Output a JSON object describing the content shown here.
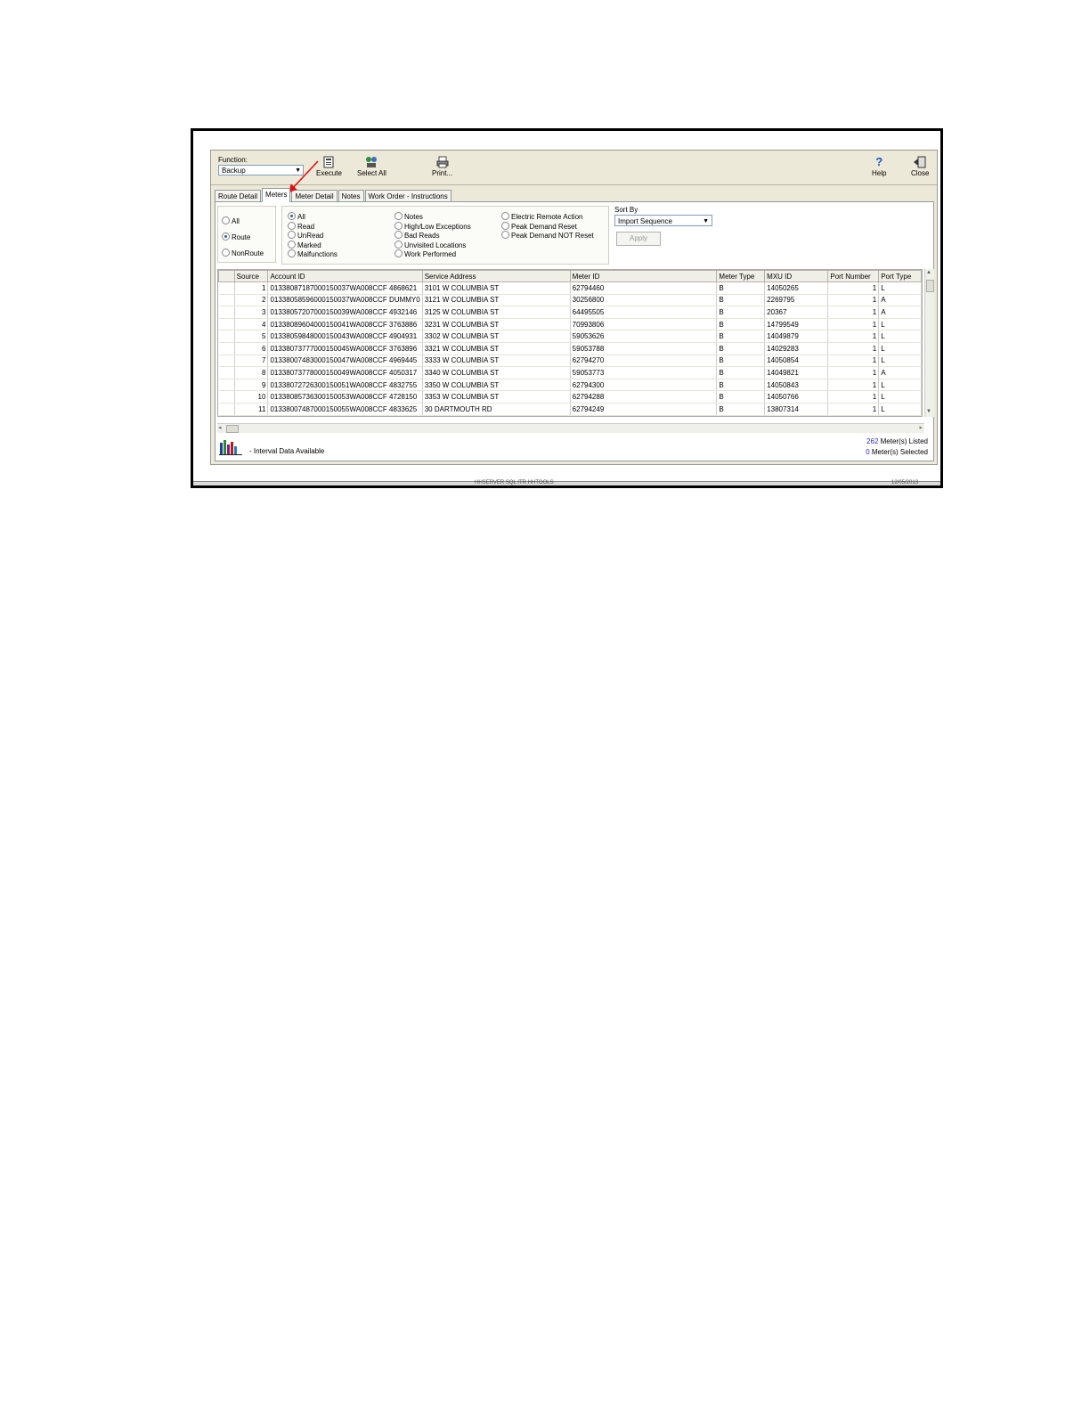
{
  "toolbar": {
    "function_label": "Function:",
    "function_value": "Backup",
    "execute_label": "Execute",
    "select_all_label": "Select All",
    "print_label": "Print...",
    "help_label": "Help",
    "close_label": "Close"
  },
  "tabs": [
    {
      "label": "Route Detail"
    },
    {
      "label": "Meters"
    },
    {
      "label": "Meter Detail"
    },
    {
      "label": "Notes"
    },
    {
      "label": "Work Order - Instructions"
    }
  ],
  "scope_filter": {
    "options": [
      {
        "label": "All",
        "selected": false
      },
      {
        "label": "Route",
        "selected": true
      },
      {
        "label": "NonRoute",
        "selected": false
      }
    ]
  },
  "status_filter": {
    "col1": [
      {
        "label": "All",
        "selected": true
      },
      {
        "label": "Read",
        "selected": false
      },
      {
        "label": "UnRead",
        "selected": false
      },
      {
        "label": "Marked",
        "selected": false
      },
      {
        "label": "Malfunctions",
        "selected": false
      }
    ],
    "col2": [
      {
        "label": "Notes",
        "selected": false
      },
      {
        "label": "High/Low Exceptions",
        "selected": false
      },
      {
        "label": "Bad Reads",
        "selected": false
      },
      {
        "label": "Unvisited Locations",
        "selected": false
      },
      {
        "label": "Work Performed",
        "selected": false
      }
    ],
    "col3": [
      {
        "label": "Electric Remote Action",
        "selected": false
      },
      {
        "label": "Peak Demand Reset",
        "selected": false
      },
      {
        "label": "Peak Demand NOT Reset",
        "selected": false
      }
    ]
  },
  "sort": {
    "label": "Sort By",
    "value": "Import Sequence",
    "apply_label": "Apply"
  },
  "grid": {
    "columns": [
      "Source",
      "Account ID",
      "Service Address",
      "Meter ID",
      "Meter Type",
      "MXU ID",
      "Port Number",
      "Port Type"
    ],
    "rows": [
      [
        "1",
        "01338087187000150037WA008CCF 4868621",
        "3101 W COLUMBIA ST",
        "62794460",
        "B",
        "14050265",
        "1",
        "L"
      ],
      [
        "2",
        "01338058596000150037WA008CCF DUMMY0",
        "3121 W COLUMBIA ST",
        "30256800",
        "B",
        "2269795",
        "1",
        "A"
      ],
      [
        "3",
        "01338057207000150039WA008CCF 4932146",
        "3125 W COLUMBIA ST",
        "64495505",
        "B",
        "20367",
        "1",
        "A"
      ],
      [
        "4",
        "01338089604000150041WA008CCF 3763886",
        "3231 W COLUMBIA ST",
        "70993806",
        "B",
        "14799549",
        "1",
        "L"
      ],
      [
        "5",
        "01338059848000150043WA008CCF 4904931",
        "3302 W COLUMBIA ST",
        "59053626",
        "B",
        "14049879",
        "1",
        "L"
      ],
      [
        "6",
        "01338073777000150045WA008CCF 3763896",
        "3321 W COLUMBIA ST",
        "59053788",
        "B",
        "14029283",
        "1",
        "L"
      ],
      [
        "7",
        "01338007483000150047WA008CCF 4969445",
        "3333 W COLUMBIA ST",
        "62794270",
        "B",
        "14050854",
        "1",
        "L"
      ],
      [
        "8",
        "01338073778000150049WA008CCF 4050317",
        "3340 W COLUMBIA ST",
        "59053773",
        "B",
        "14049821",
        "1",
        "A"
      ],
      [
        "9",
        "01338072726300150051WA008CCF 4832755",
        "3350 W COLUMBIA ST",
        "62794300",
        "B",
        "14050843",
        "1",
        "L"
      ],
      [
        "10",
        "01338085736300150053WA008CCF 4728150",
        "3353 W COLUMBIA ST",
        "62794288",
        "B",
        "14050766",
        "1",
        "L"
      ],
      [
        "11",
        "01338007487000150055WA008CCF 4833625",
        "30 DARTMOUTH RD",
        "62794249",
        "B",
        "13807314",
        "1",
        "L"
      ]
    ]
  },
  "footer": {
    "legend_text": "- Interval Data Available",
    "listed_count": "262",
    "listed_label": "Meter(s) Listed",
    "selected_count": "0",
    "selected_label": "Meter(s) Selected"
  },
  "statusbar": {
    "center": "HHSERVER SQL ITR HHTOOLS",
    "right": "12/05/2013"
  },
  "colors": {
    "annotation_arrow": "#e01010",
    "count_highlight": "#2a2ac8"
  }
}
